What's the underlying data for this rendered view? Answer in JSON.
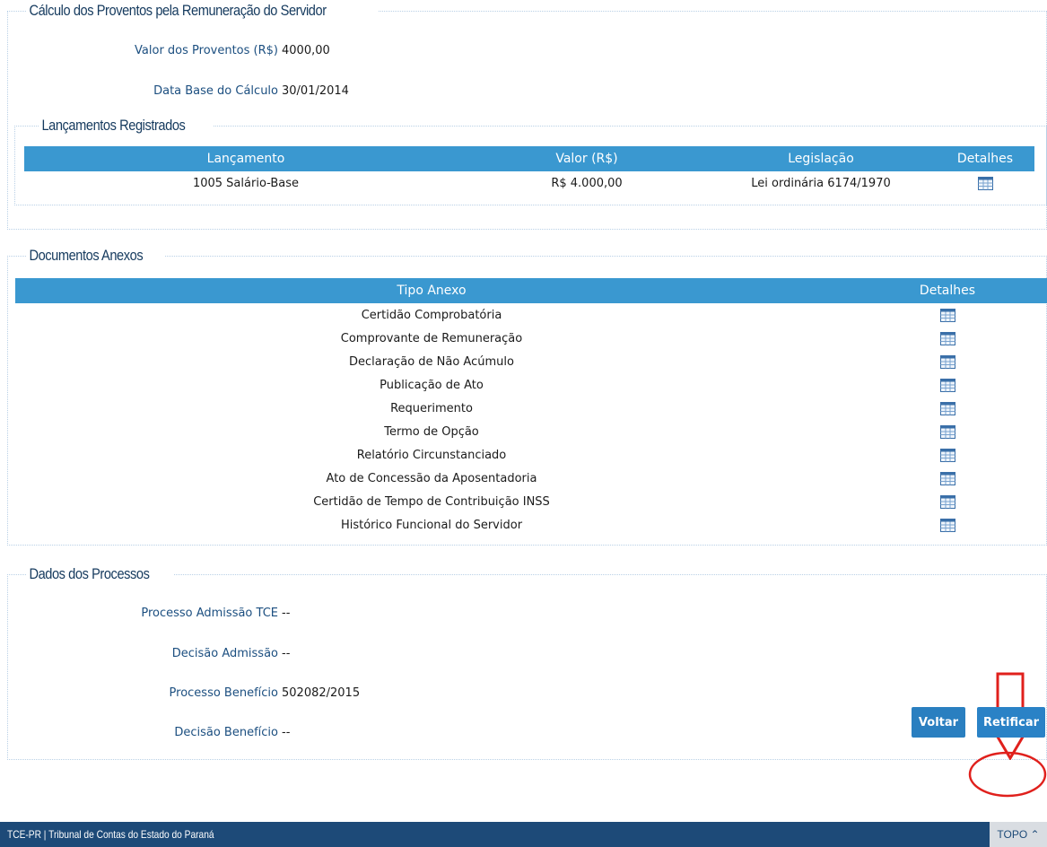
{
  "calculo": {
    "legend": "Cálculo dos Proventos pela Remuneração do Servidor",
    "valor_label": "Valor dos Proventos (R$)",
    "valor_value": "4000,00",
    "data_label": "Data Base do Cálculo",
    "data_value": "30/01/2014"
  },
  "lancamentos": {
    "legend": "Lançamentos Registrados",
    "headers": [
      "Lançamento",
      "Valor (R$)",
      "Legislação",
      "Detalhes"
    ],
    "rows": [
      {
        "lancamento": "1005 Salário-Base",
        "valor": "R$ 4.000,00",
        "legislacao": "Lei ordinária 6174/1970",
        "icon": "grid-details-icon"
      }
    ]
  },
  "documentos": {
    "legend": "Documentos Anexos",
    "headers": [
      "Tipo Anexo",
      "Detalhes"
    ],
    "rows": [
      {
        "tipo": "Certidão Comprobatória"
      },
      {
        "tipo": "Comprovante de Remuneração"
      },
      {
        "tipo": "Declaração de Não Acúmulo"
      },
      {
        "tipo": "Publicação de Ato"
      },
      {
        "tipo": "Requerimento"
      },
      {
        "tipo": "Termo de Opção"
      },
      {
        "tipo": "Relatório Circunstanciado"
      },
      {
        "tipo": "Ato de Concessão da Aposentadoria"
      },
      {
        "tipo": "Certidão de Tempo de Contribuição INSS"
      },
      {
        "tipo": "Histórico Funcional do Servidor"
      }
    ]
  },
  "processos": {
    "legend": "Dados dos Processos",
    "fields": [
      {
        "label": "Processo Admissão TCE",
        "value": "--"
      },
      {
        "label": "Decisão Admissão",
        "value": "--"
      },
      {
        "label": "Processo Benefício",
        "value": "502082/2015"
      },
      {
        "label": "Decisão Benefício",
        "value": "--"
      }
    ]
  },
  "buttons": {
    "voltar": "Voltar",
    "retificar": "Retificar"
  },
  "footer": {
    "text": "TCE-PR | Tribunal de Contas do Estado do Paraná",
    "topo": "TOPO ⌃"
  },
  "colors": {
    "header_blue": "#3a98d0",
    "footer_blue": "#1d4a78",
    "button_blue": "#2a7fc0",
    "annotation_red": "#e0201c"
  }
}
